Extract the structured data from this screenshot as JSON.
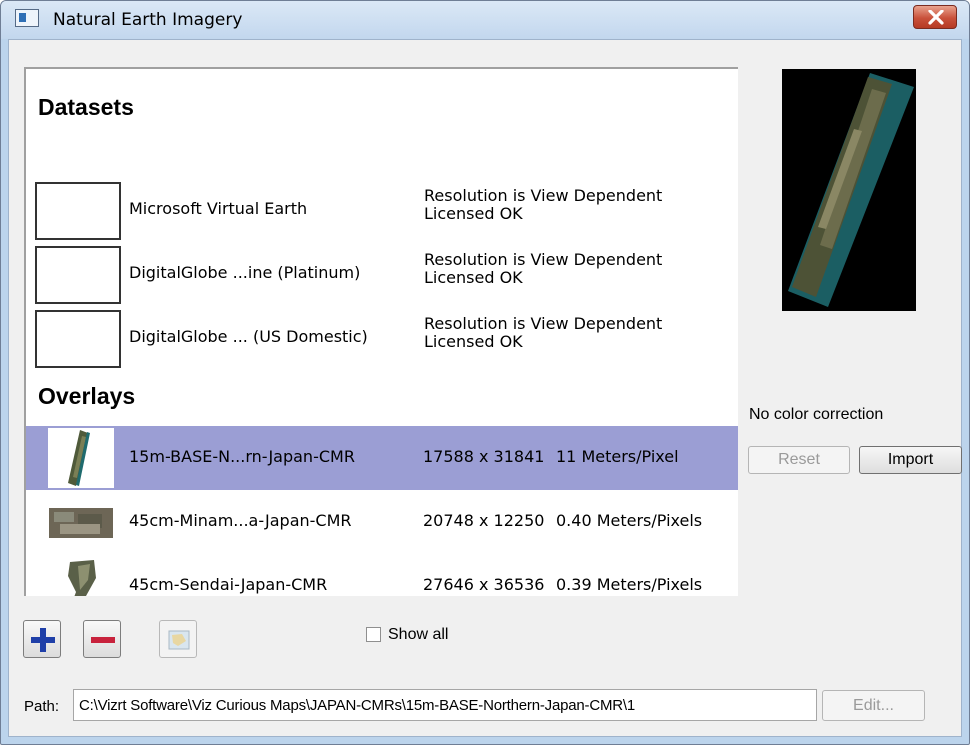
{
  "window": {
    "title": "Natural Earth Imagery"
  },
  "datasets": {
    "title": "Datasets",
    "rows": [
      {
        "name": "Microsoft Virtual Earth",
        "resolution": "Resolution is View Dependent",
        "license": "Licensed OK"
      },
      {
        "name": "DigitalGlobe ...ine (Platinum)",
        "resolution": "Resolution is View Dependent",
        "license": "Licensed OK"
      },
      {
        "name": "DigitalGlobe ... (US Domestic)",
        "resolution": "Resolution is View Dependent",
        "license": "Licensed OK"
      }
    ]
  },
  "overlays": {
    "title": "Overlays",
    "rows": [
      {
        "name": "15m-BASE-N...rn-Japan-CMR",
        "size": "17588 x 31841",
        "resolution": "11 Meters/Pixel",
        "selected": true
      },
      {
        "name": "45cm-Minam...a-Japan-CMR",
        "size": "20748 x 12250",
        "resolution": "0.40 Meters/Pixels",
        "selected": false
      },
      {
        "name": "45cm-Sendai-Japan-CMR",
        "size": "27646 x 36536",
        "resolution": "0.39 Meters/Pixels",
        "selected": false
      }
    ]
  },
  "color_correction": {
    "status": "No color correction",
    "reset_label": "Reset",
    "import_label": "Import"
  },
  "toolbar": {
    "add_icon": "plus-icon",
    "remove_icon": "minus-icon",
    "map_icon": "map-icon",
    "show_all_label": "Show all",
    "show_all_checked": false
  },
  "path": {
    "label": "Path:",
    "value": "C:\\Vizrt Software\\Viz Curious Maps\\JAPAN-CMRs\\15m-BASE-Northern-Japan-CMR\\1",
    "edit_label": "Edit..."
  },
  "colors": {
    "selection": "#9b9ed4",
    "titlebar": "#c2d7ee",
    "close_button": "#c9513b",
    "add_icon": "#1f3fa8",
    "remove_icon": "#c8223c"
  }
}
